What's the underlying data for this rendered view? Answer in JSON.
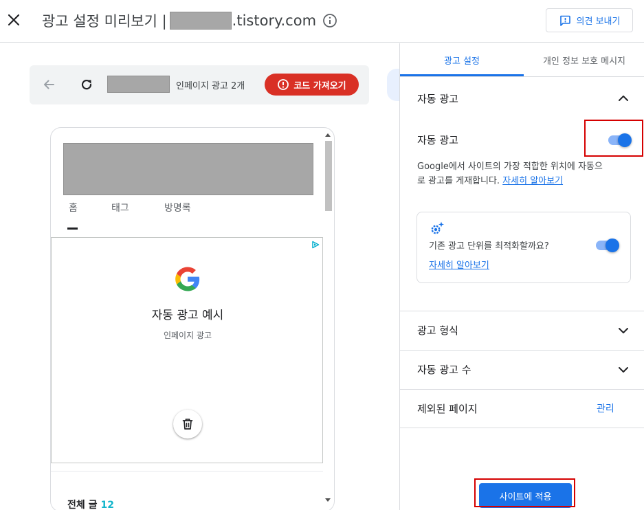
{
  "header": {
    "title_prefix": "광고 설정 미리보기 |",
    "title_suffix": ".tistory.com",
    "feedback_label": "의견 보내기",
    "icons": [
      "close-icon",
      "info-icon",
      "feedback-icon"
    ]
  },
  "preview": {
    "page_count_label": "인페이지 광고 2개",
    "code_button_label": "코드 가져오기",
    "nav": [
      "홈",
      "태그",
      "방명록"
    ],
    "ad_title": "자동 광고 예시",
    "ad_subtitle": "인페이지 광고",
    "total_label": "전체 글",
    "total_count": "12",
    "icons": [
      "back-arrow-icon",
      "refresh-icon",
      "alert-icon",
      "adchoices-icon",
      "google-logo",
      "trash-icon"
    ]
  },
  "settings": {
    "tabs": [
      "광고 설정",
      "개인 정보 보호 메시지"
    ],
    "active_tab": "광고 설정",
    "auto_ads_section": "자동 광고",
    "auto_ads_toggle_label": "자동 광고",
    "auto_ads_enabled": true,
    "auto_ads_desc": "Google에서 사이트의 가장 적합한 위치에 자동으로 광고를 게재합니다.",
    "learn_more": "자세히 알아보기",
    "optimize_question": "기존 광고 단위를 최적화할까요?",
    "optimize_enabled": true,
    "optimize_learn_more": "자세히 알아보기",
    "ad_formats": "광고 형식",
    "ad_load": "자동 광고 수",
    "excluded_pages": "제외된 페이지",
    "manage": "관리",
    "apply_button": "사이트에 적용"
  },
  "colors": {
    "accent": "#1a73e8",
    "danger": "#d93025",
    "highlight": "#d50000",
    "toggle_track": "#8ab4f8",
    "teal": "#12b5cb"
  }
}
